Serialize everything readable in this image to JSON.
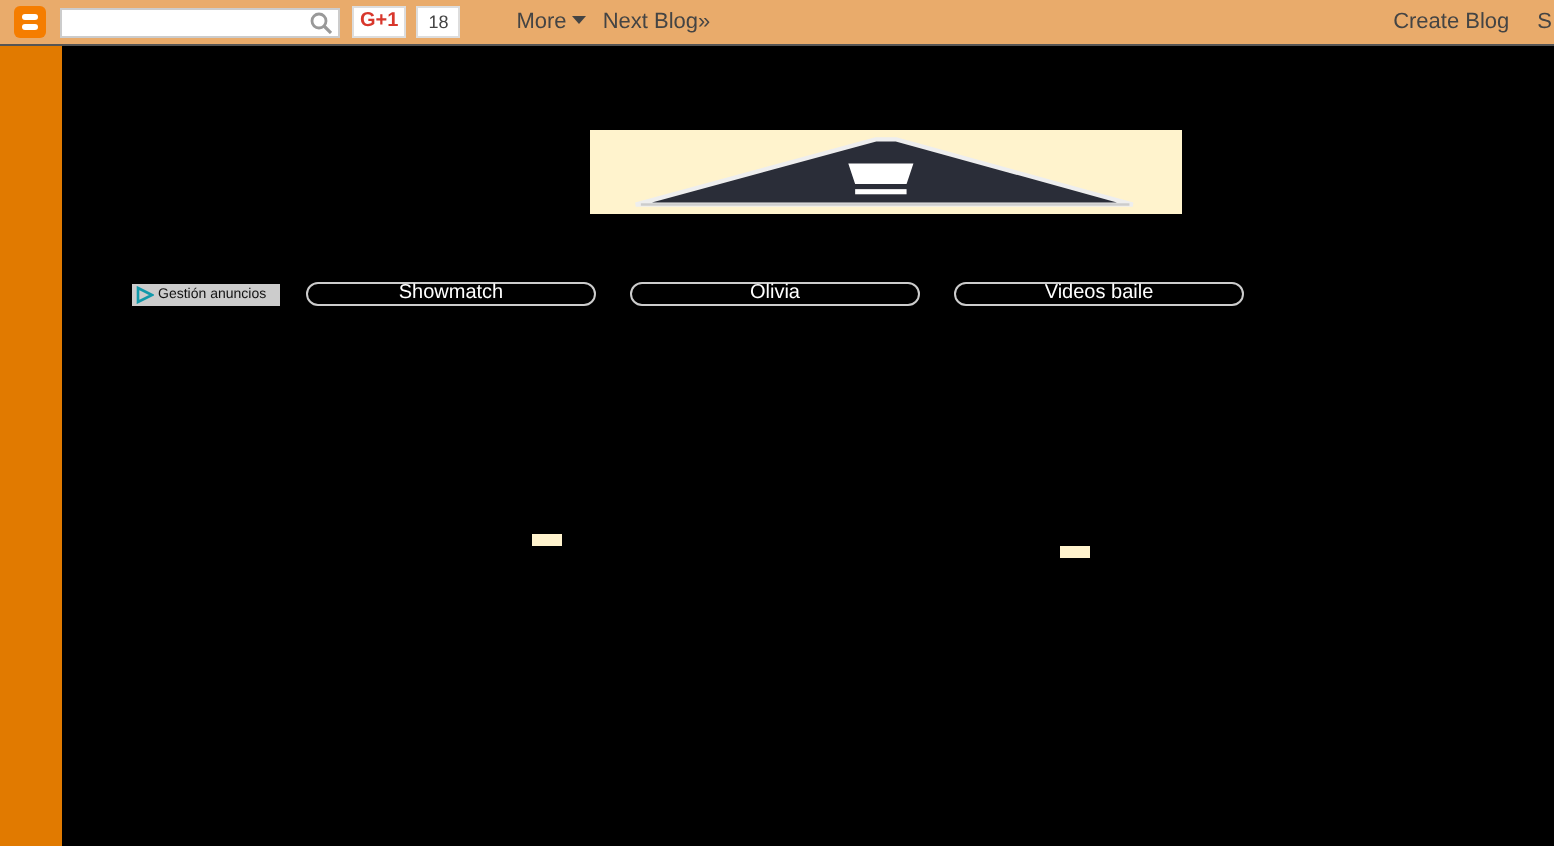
{
  "navbar": {
    "plus_button": "G+1",
    "plus_count": "18",
    "menus": [
      {
        "label": "More",
        "kind": "dropdown"
      },
      {
        "label": "Next Blog»",
        "kind": "link"
      }
    ],
    "right_links": [
      "Create Blog",
      "S"
    ]
  },
  "ads_link": "Gestión anuncios",
  "links": [
    {
      "label": "Showmatch"
    },
    {
      "label": "Olivia"
    },
    {
      "label": "Videos baile"
    }
  ]
}
